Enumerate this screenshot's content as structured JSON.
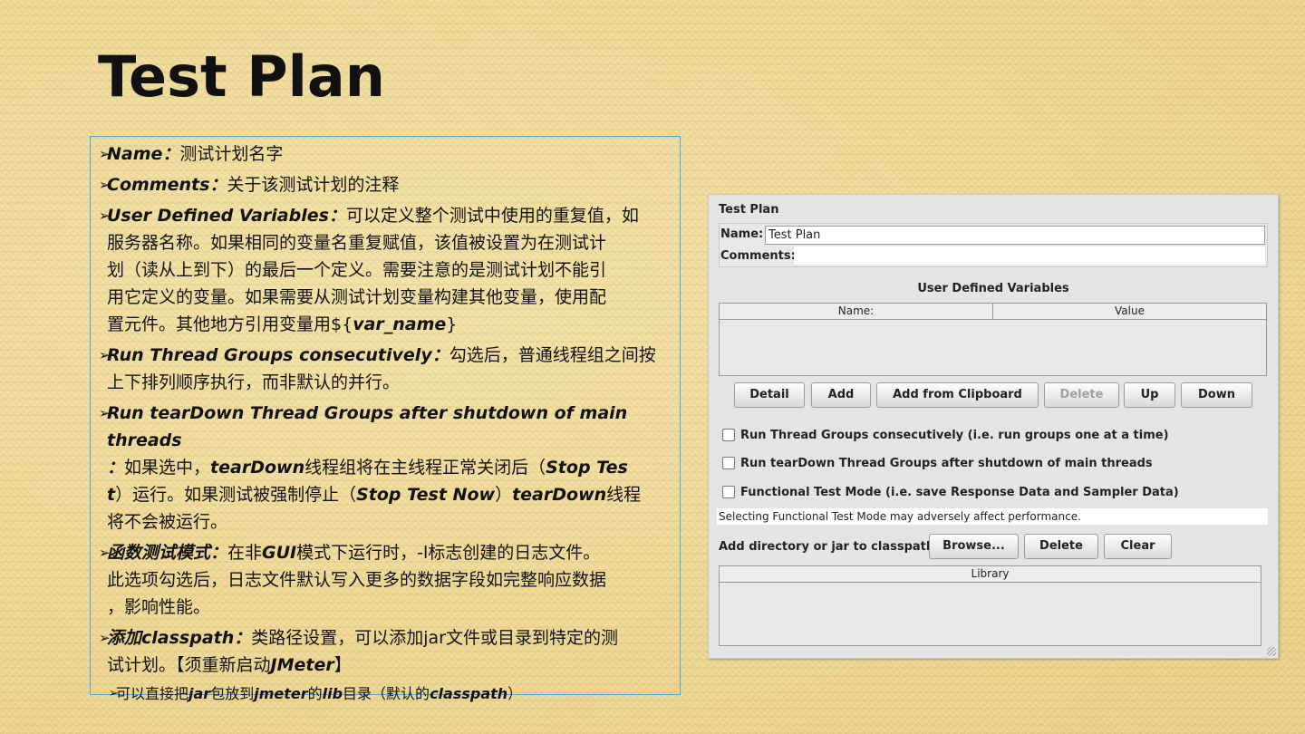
{
  "slide": {
    "title": "Test Plan"
  },
  "notes": [
    {
      "term": "Name：",
      "text": "测试计划名字"
    },
    {
      "term": "Comments：",
      "text": "关于该测试计划的注释"
    },
    {
      "term": "User Defined Variables：",
      "text": "可以定义整个测试中使用的重复值，如",
      "cont": [
        "服务器名称。如果相同的变量名重复赋值，该值被设置为在测试计",
        "划（读从上到下）的最后一个定义。需要注意的是测试计划不能引",
        "用它定义的变量。如果需要从测试计划变量构建其他变量，使用配"
      ],
      "last_pre": "置元件。其他地方引用变量用${",
      "last_em": "var_name",
      "last_post": "}"
    },
    {
      "term": "Run Thread Groups consecutively：",
      "text": "勾选后，普通线程组之间按",
      "cont": [
        "上下排列顺序执行，而非默认的并行。"
      ]
    },
    {
      "term": "Run tearDown Thread Groups after shutdown of main threads",
      "line2_a": "：",
      "line2_b": "如果选中，",
      "line2_c": "tearDown",
      "line2_d": "线程组将在主线程正常关闭后（",
      "line2_e": "Stop Tes",
      "line3_a": "t",
      "line3_b": "）运行。如果测试被强制停止（",
      "line3_c": "Stop Test Now",
      "line3_d": "）",
      "line3_e": "tearDown",
      "line3_f": "线程",
      "line4": "将不会被运行。"
    },
    {
      "term": "函数测试模式：",
      "text_a": "在非",
      "text_em": "GUI",
      "text_b": "模式下运行时，-l标志创建的日志文件。",
      "cont": [
        "此选项勾选后，日志文件默认写入更多的数据字段如完整响应数据",
        "，影响性能。"
      ]
    },
    {
      "term": "添加classpath：",
      "text": "类路径设置，可以添加jar文件或目录到特定的测",
      "cont_a": "试计划。【须重新启动",
      "cont_em": "JMeter",
      "cont_b": "】"
    },
    {
      "a": "可以直接把",
      "b": "jar",
      "c": "包放到",
      "d": "jmeter",
      "e": "的",
      "f": "lib",
      "g": "目录（默认的",
      "h": "classpath",
      "i": "）"
    }
  ],
  "arrow": "➢",
  "panel": {
    "title": "Test Plan",
    "name_label": "Name:",
    "name_value": "Test Plan",
    "comments_label": "Comments:",
    "udv_title": "User Defined Variables",
    "udv_columns": [
      "Name:",
      "Value"
    ],
    "buttons": [
      "Detail",
      "Add",
      "Add from Clipboard",
      "Delete",
      "Up",
      "Down"
    ],
    "checkboxes": [
      "Run Thread Groups consecutively (i.e. run groups one at a time)",
      "Run tearDown Thread Groups after shutdown of main threads",
      "Functional Test Mode (i.e. save Response Data and Sampler Data)"
    ],
    "note": "Selecting Functional Test Mode may adversely affect performance.",
    "classpath_label": "Add directory or jar to classpath",
    "classpath_buttons": [
      "Browse...",
      "Delete",
      "Clear"
    ],
    "library_column": "Library"
  }
}
